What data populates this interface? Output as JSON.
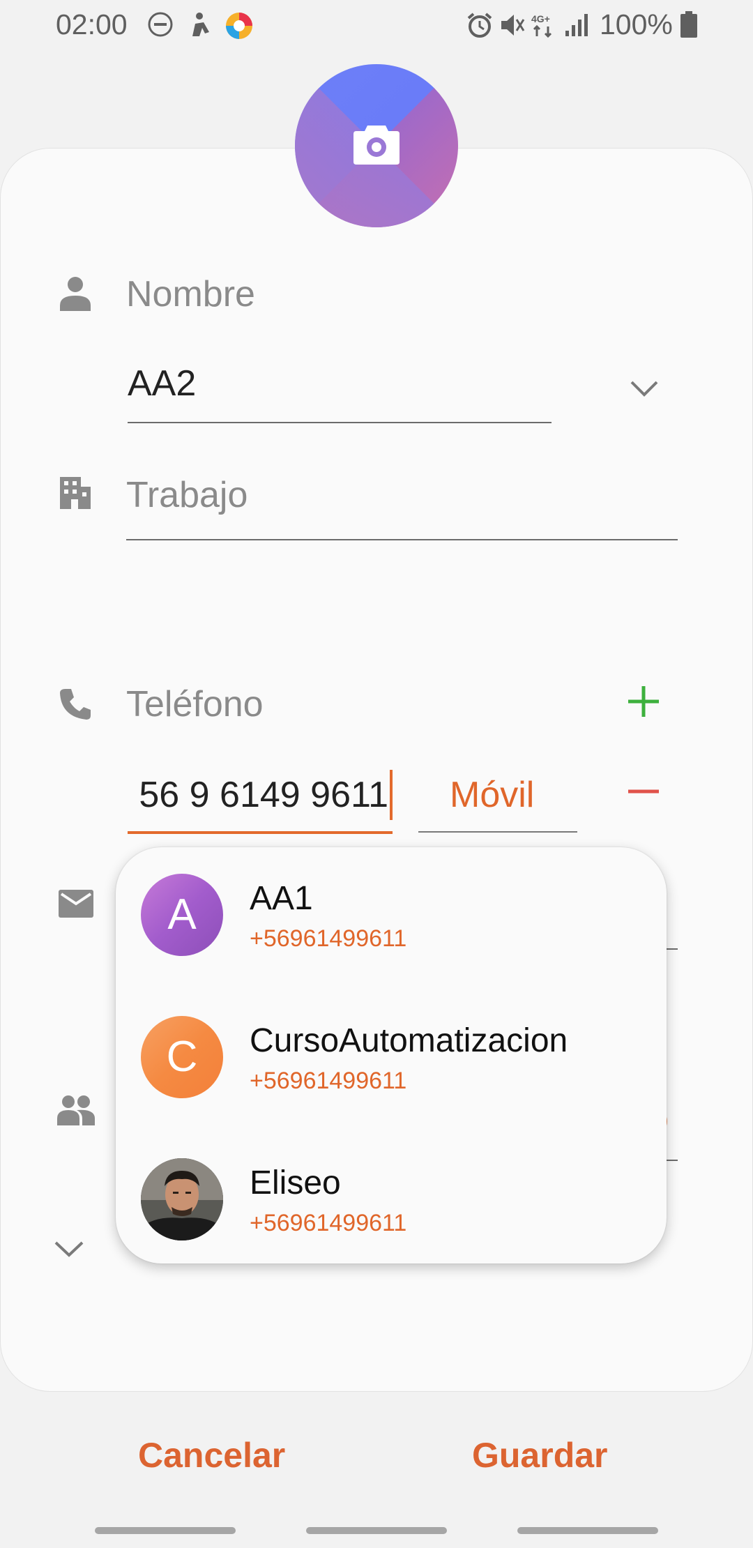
{
  "status_bar": {
    "time": "02:00",
    "battery": "100%",
    "icons_left": [
      "do-not-disturb-icon",
      "notification-figure-icon",
      "browser-app-icon"
    ],
    "icons_right": [
      "alarm-icon",
      "mute-icon",
      "network-4g-icon",
      "signal-icon",
      "battery-icon"
    ]
  },
  "contact_form": {
    "name_label": "Nombre",
    "name_value": "AA2",
    "work_label": "Trabajo",
    "phone_label": "Teléfono",
    "phone_value": "56 9 6149 9611",
    "phone_type": "Móvil"
  },
  "suggestions": [
    {
      "initial": "A",
      "name": "AA1",
      "number": "+56961499611",
      "color": "#a65fc8"
    },
    {
      "initial": "C",
      "name": "CursoAutomatizacion",
      "number": "+56961499611",
      "color": "#f58a42"
    },
    {
      "initial": "",
      "name": "Eliseo",
      "number": "+56961499611",
      "color": "#3a3a3a"
    }
  ],
  "partial_hidden_text": "o",
  "actions": {
    "cancel": "Cancelar",
    "save": "Guardar"
  },
  "colors": {
    "accent": "#dc6431",
    "add_green": "#3db03d",
    "remove_red": "#e0524a"
  }
}
